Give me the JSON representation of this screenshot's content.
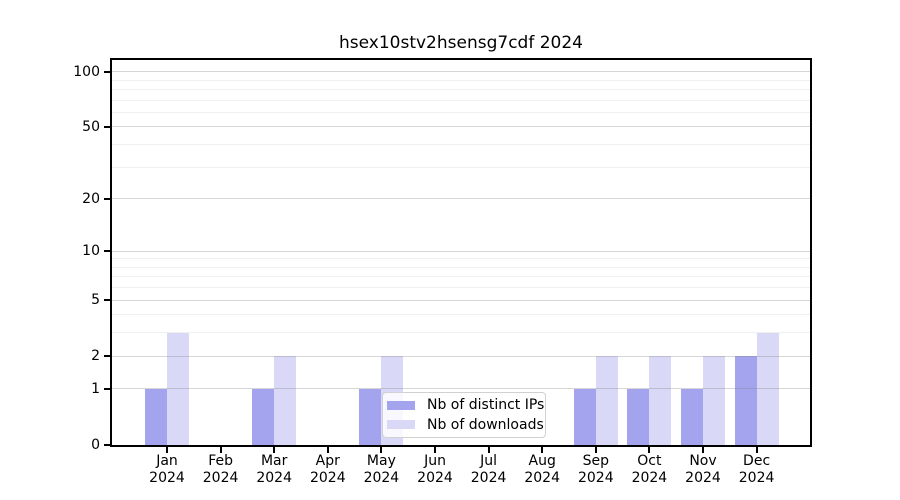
{
  "chart_data": {
    "type": "bar",
    "title": "hsex10stv2hsensg7cdf 2024",
    "xlabel": "",
    "ylabel": "",
    "yscale": "symlog",
    "ylim": [
      0,
      115
    ],
    "yticks_major": [
      0,
      1,
      2,
      5,
      10,
      20,
      50,
      100
    ],
    "yticks_minor": [
      3,
      4,
      6,
      7,
      8,
      9,
      30,
      40,
      60,
      70,
      80,
      90
    ],
    "grid": "horizontal-major-and-minor",
    "legend_position": "lower-center",
    "x_tick_labels": [
      {
        "month": "Jan",
        "year": "2024"
      },
      {
        "month": "Feb",
        "year": "2024"
      },
      {
        "month": "Mar",
        "year": "2024"
      },
      {
        "month": "Apr",
        "year": "2024"
      },
      {
        "month": "May",
        "year": "2024"
      },
      {
        "month": "Jun",
        "year": "2024"
      },
      {
        "month": "Jul",
        "year": "2024"
      },
      {
        "month": "Aug",
        "year": "2024"
      },
      {
        "month": "Sep",
        "year": "2024"
      },
      {
        "month": "Oct",
        "year": "2024"
      },
      {
        "month": "Nov",
        "year": "2024"
      },
      {
        "month": "Dec",
        "year": "2024"
      }
    ],
    "series": [
      {
        "name": "Nb of distinct IPs",
        "color": "#a4a4ee",
        "values": [
          1,
          0,
          1,
          0,
          1,
          0,
          0,
          0,
          1,
          1,
          1,
          2
        ]
      },
      {
        "name": "Nb of downloads",
        "color": "#d9d9f7",
        "values": [
          3,
          0,
          2,
          0,
          2,
          0,
          0,
          0,
          2,
          2,
          2,
          3
        ]
      }
    ]
  }
}
